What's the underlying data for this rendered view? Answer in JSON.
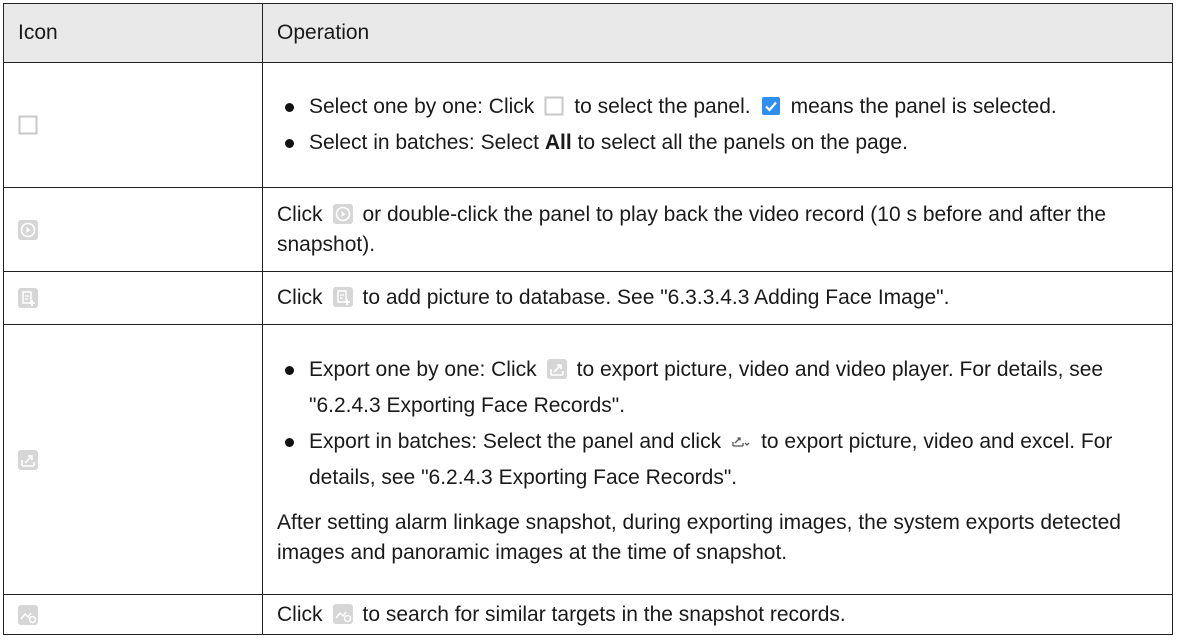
{
  "headers": {
    "icon": "Icon",
    "operation": "Operation"
  },
  "row1": {
    "b1_pre": "Select one by one: Click",
    "b1_mid": "to select the panel.",
    "b1_post": "means the panel is selected.",
    "b2_pre": "Select in batches: Select",
    "b2_bold": "All",
    "b2_post": "to select all the panels on the page."
  },
  "row2": {
    "pre": "Click",
    "post": "or double-click the panel to play back the video record (10 s before and after the snapshot)."
  },
  "row3": {
    "pre": "Click",
    "post": "to add picture to database. See \"6.3.3.4.3 Adding Face Image\"."
  },
  "row4": {
    "b1_pre": "Export one by one: Click",
    "b1_post": "to export picture, video and video player. For details, see \"6.2.4.3 Exporting Face Records\".",
    "b2_pre": "Export in batches: Select the panel and click",
    "b2_post": "to export picture, video and excel. For details, see \"6.2.4.3 Exporting Face Records\".",
    "note": "After setting alarm linkage snapshot, during exporting images, the system exports detected images and panoramic images at the time of snapshot."
  },
  "row5": {
    "pre": "Click",
    "post": "to search for similar targets in the snapshot records."
  }
}
